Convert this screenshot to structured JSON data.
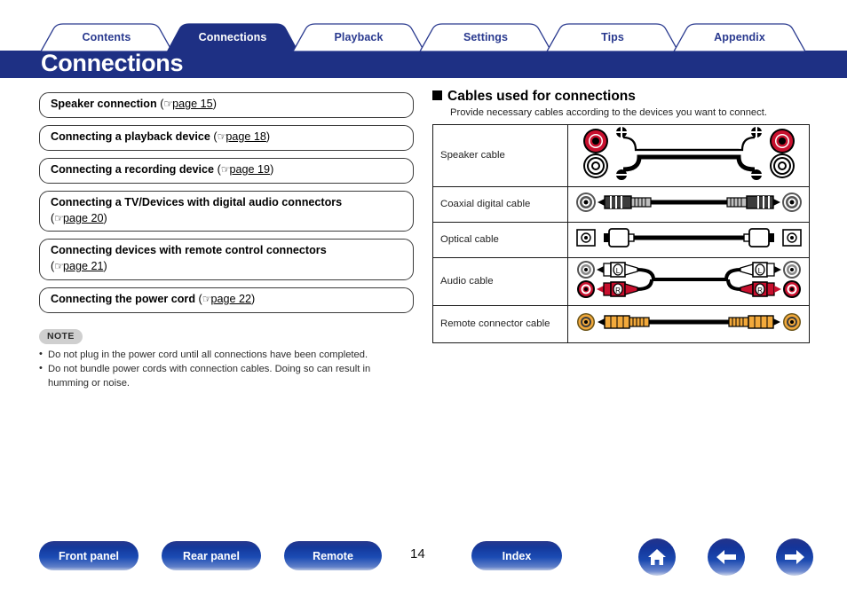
{
  "tabs": [
    {
      "label": "Contents",
      "active": false
    },
    {
      "label": "Connections",
      "active": true
    },
    {
      "label": "Playback",
      "active": false
    },
    {
      "label": "Settings",
      "active": false
    },
    {
      "label": "Tips",
      "active": false
    },
    {
      "label": "Appendix",
      "active": false
    }
  ],
  "header": {
    "title": "Connections",
    "band_color": "#1e3084",
    "tab_text_color": "#2a3a8f"
  },
  "left_column": {
    "links": [
      {
        "title": "Speaker connection",
        "ref_open": "(",
        "hand": "☞",
        "page": "page 15",
        "ref_close": ")",
        "inline": true
      },
      {
        "title": "Connecting a playback device",
        "ref_open": "(",
        "hand": "☞",
        "page": "page 18",
        "ref_close": ")",
        "inline": true
      },
      {
        "title": "Connecting a recording device",
        "ref_open": "(",
        "hand": "☞",
        "page": "page 19",
        "ref_close": ")",
        "inline": true
      },
      {
        "title": "Connecting a TV/Devices with digital audio connectors",
        "ref_open": "(",
        "hand": "☞",
        "page": "page 20",
        "ref_close": ")",
        "inline": false
      },
      {
        "title": "Connecting devices with remote control connectors",
        "ref_open": "(",
        "hand": "☞",
        "page": "page 21",
        "ref_close": ")",
        "inline": false
      },
      {
        "title": "Connecting the power cord",
        "ref_open": "(",
        "hand": "☞",
        "page": "page 22",
        "ref_close": ")",
        "inline": true
      }
    ],
    "note": {
      "badge": "NOTE",
      "items": [
        "Do not plug in the power cord until all connections have been completed.",
        "Do not bundle power cords with connection cables. Doing so can result in humming or noise."
      ]
    }
  },
  "right_column": {
    "section_title": "Cables used for connections",
    "section_subtitle": "Provide necessary cables according to the devices you want to connect.",
    "table": {
      "rows": [
        {
          "name": "Speaker cable",
          "diagram": "speaker-cable-diagram"
        },
        {
          "name": "Coaxial digital cable",
          "diagram": "coaxial-digital-cable-diagram"
        },
        {
          "name": "Optical cable",
          "diagram": "optical-cable-diagram"
        },
        {
          "name": "Audio cable",
          "diagram": "audio-cable-diagram"
        },
        {
          "name": "Remote connector cable",
          "diagram": "remote-connector-cable-diagram"
        }
      ]
    }
  },
  "footer": {
    "buttons": [
      {
        "label": "Front panel",
        "name": "front-panel-button"
      },
      {
        "label": "Rear panel",
        "name": "rear-panel-button"
      },
      {
        "label": "Remote",
        "name": "remote-button"
      },
      {
        "label": "Index",
        "name": "index-button"
      }
    ],
    "page_number": "14",
    "icons": [
      {
        "name": "home-icon"
      },
      {
        "name": "arrow-left-icon"
      },
      {
        "name": "arrow-right-icon"
      }
    ]
  },
  "colors": {
    "navy": "#1e3084",
    "button_blue": "#14399c",
    "red_terminal": "#c8102e",
    "orange_connector": "#f2a93b",
    "note_badge_bg": "#cfcfcf"
  }
}
